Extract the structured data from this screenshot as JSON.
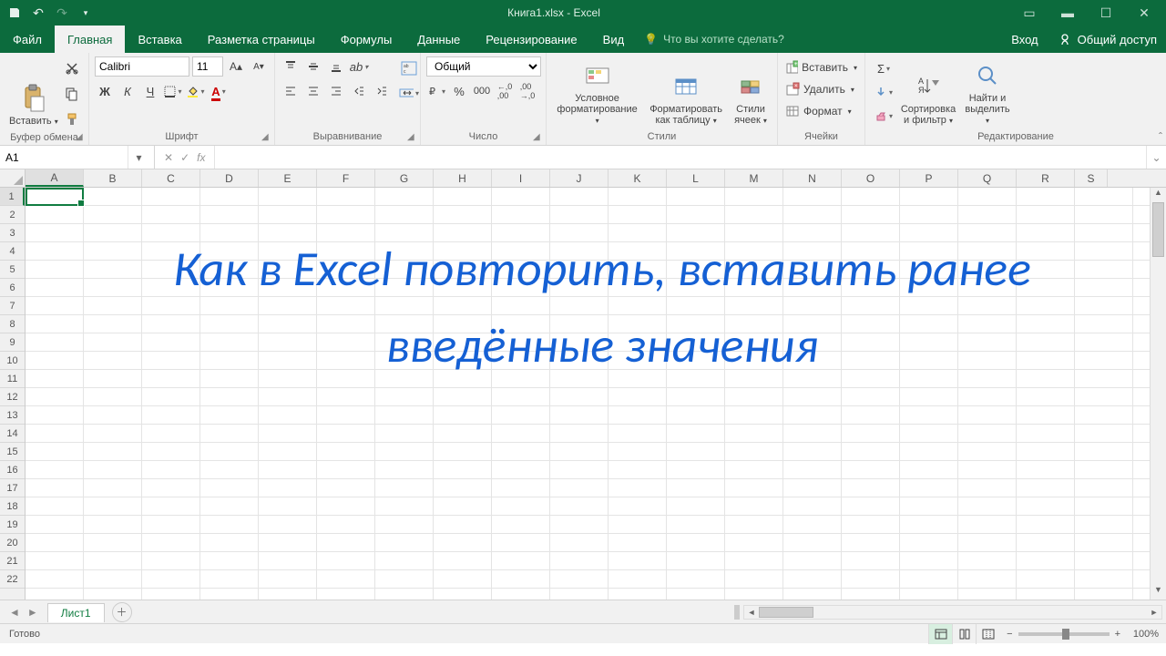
{
  "titlebar": {
    "title": "Книга1.xlsx - Excel"
  },
  "tabs": {
    "file": "Файл",
    "items": [
      "Главная",
      "Вставка",
      "Разметка страницы",
      "Формулы",
      "Данные",
      "Рецензирование",
      "Вид"
    ],
    "active": 0,
    "tellme": "Что вы хотите сделать?",
    "signin": "Вход",
    "share": "Общий доступ"
  },
  "ribbon": {
    "clipboard": {
      "paste": "Вставить",
      "label": "Буфер обмена"
    },
    "font": {
      "name": "Calibri",
      "size": "11",
      "label": "Шрифт"
    },
    "align": {
      "label": "Выравнивание"
    },
    "number": {
      "format": "Общий",
      "label": "Число"
    },
    "styles": {
      "cond": "Условное\nформатирование",
      "table": "Форматировать\nкак таблицу",
      "cell": "Стили\nячеек",
      "label": "Стили"
    },
    "cells": {
      "insert": "Вставить",
      "delete": "Удалить",
      "format": "Формат",
      "label": "Ячейки"
    },
    "editing": {
      "sort": "Сортировка\nи фильтр",
      "find": "Найти и\nвыделить",
      "label": "Редактирование"
    }
  },
  "fbar": {
    "namebox": "A1"
  },
  "grid": {
    "cols": [
      "A",
      "B",
      "C",
      "D",
      "E",
      "F",
      "G",
      "H",
      "I",
      "J",
      "K",
      "L",
      "M",
      "N",
      "O",
      "P",
      "Q",
      "R",
      "S"
    ],
    "overlay": "Как в Excel повторить, вставить ранее введённые значения"
  },
  "sheet": {
    "tab": "Лист1"
  },
  "status": {
    "ready": "Готово",
    "zoom": "100%"
  }
}
